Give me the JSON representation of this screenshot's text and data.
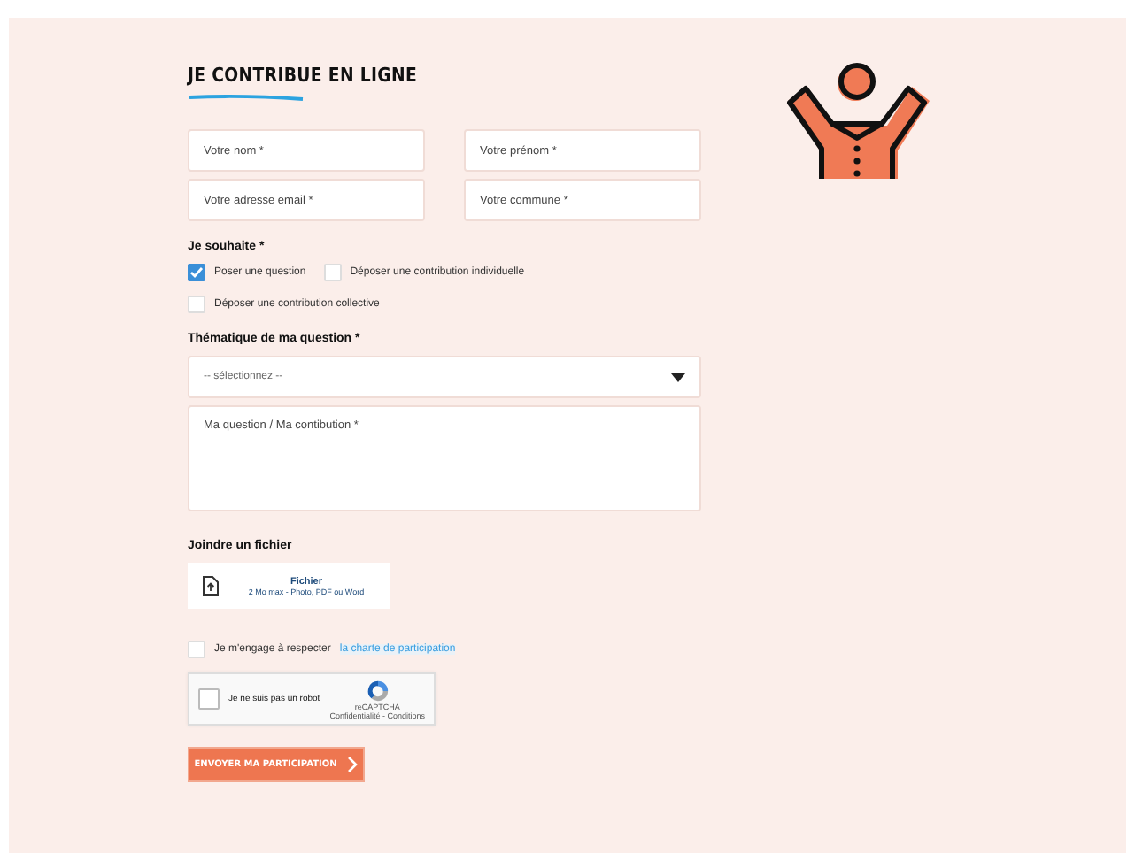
{
  "heading": "JE CONTRIBUE EN LIGNE",
  "fields": [
    {
      "placeholder": "Votre nom *"
    },
    {
      "placeholder": "Votre prénom *"
    },
    {
      "placeholder": "Votre adresse email *"
    },
    {
      "placeholder": "Votre commune *"
    }
  ],
  "wish": {
    "label": "Je souhaite *",
    "options": [
      {
        "label": "Poser une question",
        "checked": true
      },
      {
        "label": "Déposer une contribution individuelle",
        "checked": false
      },
      {
        "label": "Déposer une contribution collective",
        "checked": false
      }
    ]
  },
  "theme": {
    "label": "Thématique de ma question *",
    "select": "-- sélectionnez --"
  },
  "message": {
    "placeholder": "Ma question / Ma contibution *"
  },
  "attach": {
    "label": "Joindre un fichier",
    "title": "Fichier",
    "hint": "2 Mo max - Photo, PDF ou Word"
  },
  "charter": {
    "text": "Je m'engage à respecter",
    "link": "la charte de participation",
    "checked": false
  },
  "captcha": {
    "label": "Je ne suis pas un robot",
    "brand": "reCAPTCHA",
    "links": "Confidentialité - Conditions",
    "checked": false
  },
  "submit": "ENVOYER MA PARTICIPATION"
}
